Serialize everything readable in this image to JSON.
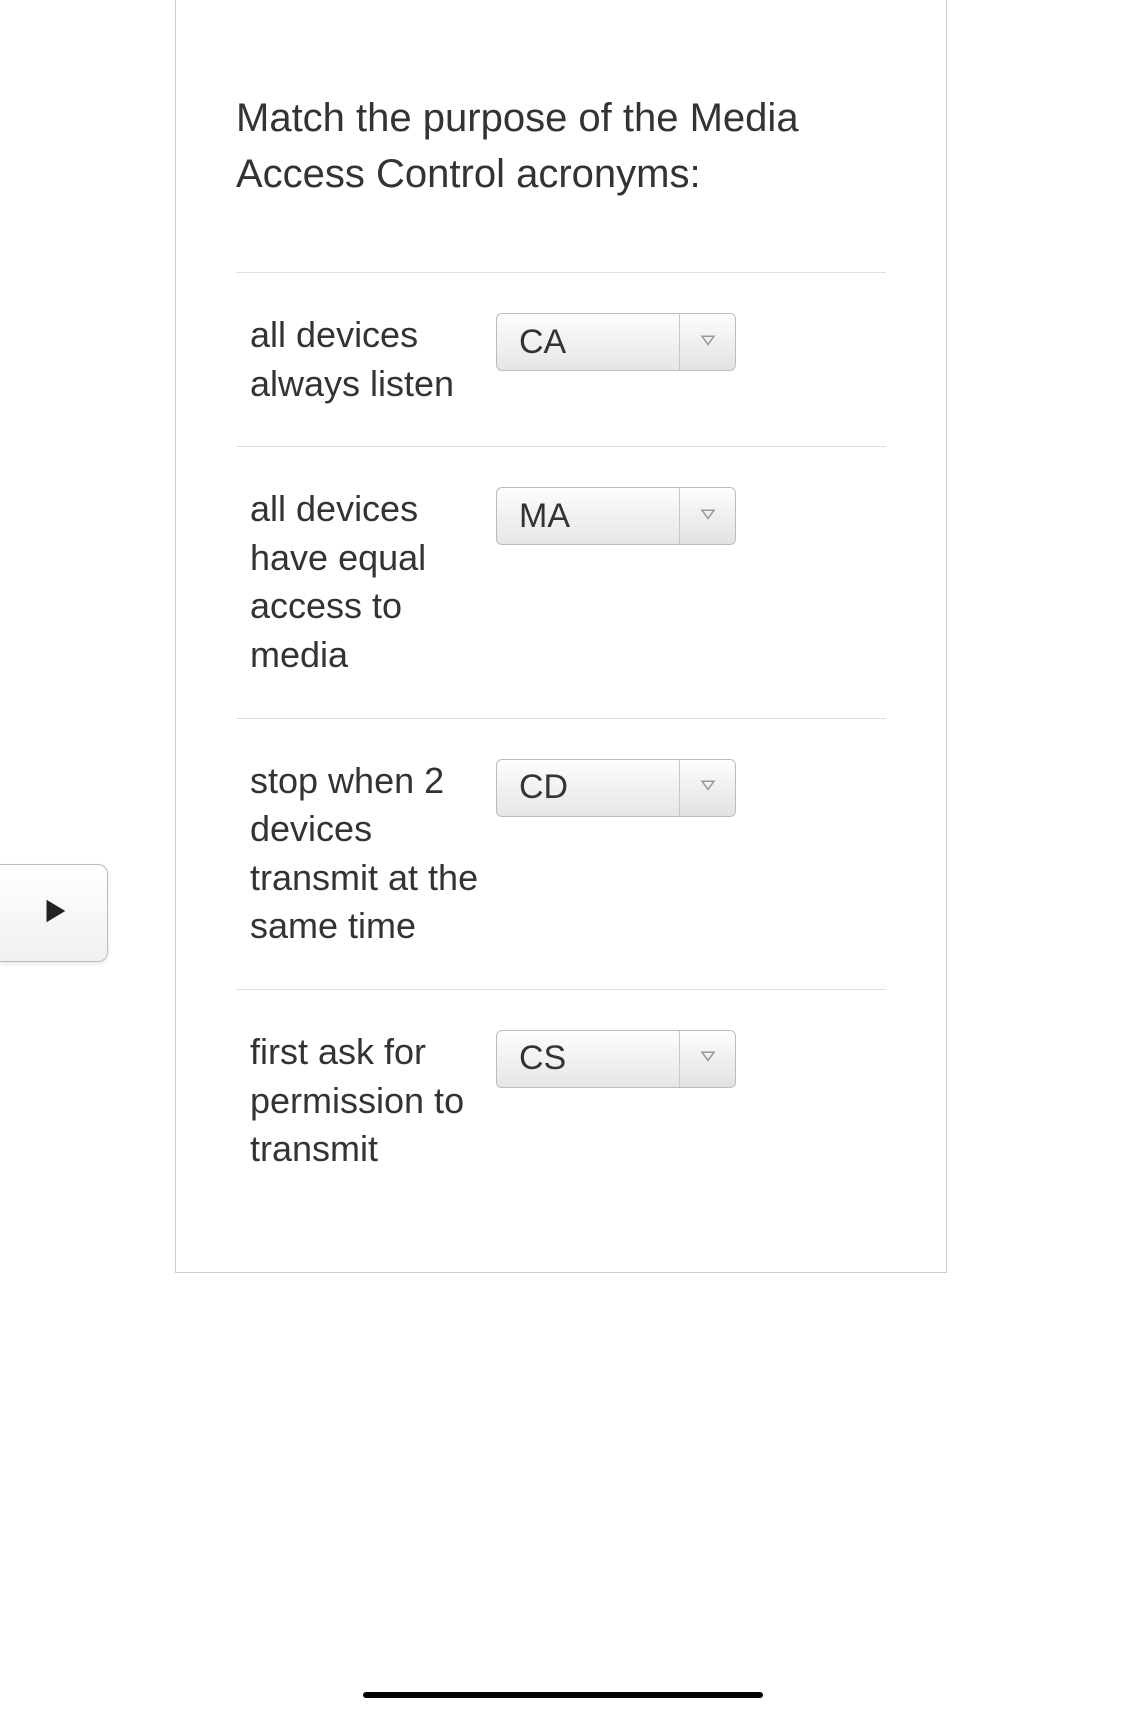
{
  "prompt": "Match the purpose of the Media Access Control acronyms:",
  "rows": [
    {
      "label": "all devices always listen",
      "value": "CA"
    },
    {
      "label": "all devices have equal access to media",
      "value": "MA"
    },
    {
      "label": "stop when 2 devices transmit at the same time",
      "value": "CD"
    },
    {
      "label": "first ask for permission to transmit",
      "value": "CS"
    }
  ]
}
